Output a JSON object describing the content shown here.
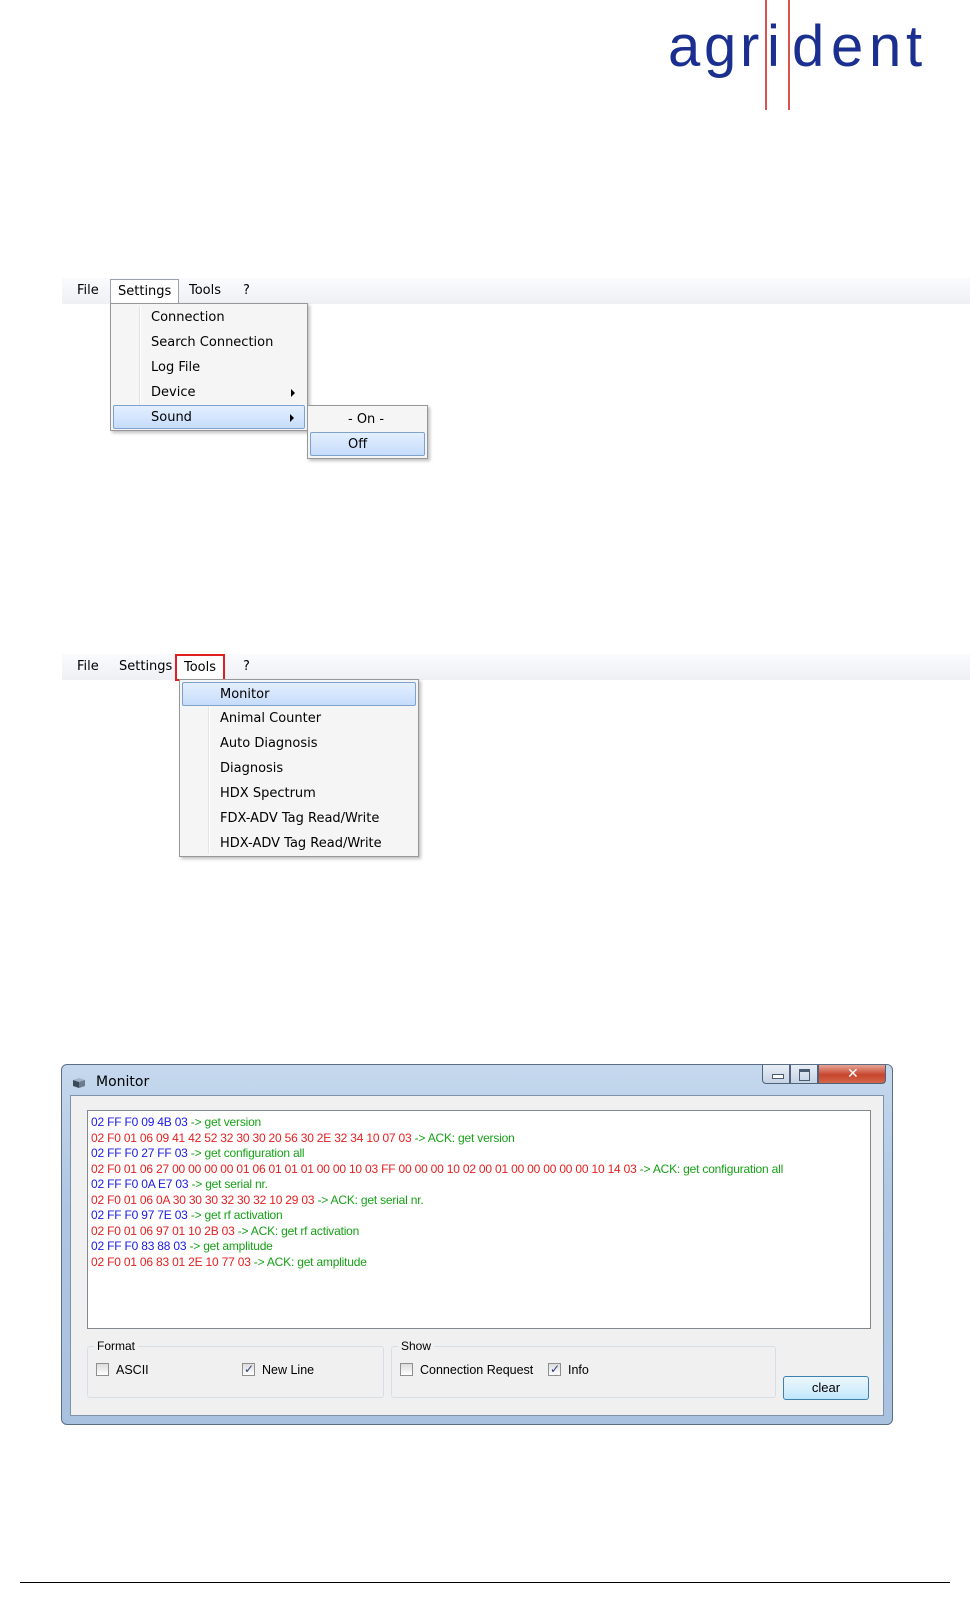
{
  "logo": {
    "text": [
      "a",
      "g",
      "r",
      "i",
      "d",
      "e",
      "n",
      "t"
    ],
    "color": "#1a2f8f",
    "accent": "#d9534f"
  },
  "menu1": {
    "items": [
      "File",
      "Settings",
      "Tools",
      "?"
    ],
    "dropdown": [
      "Connection",
      "Search Connection",
      "Log File",
      "Device",
      "Sound"
    ],
    "submenu": [
      "- On -",
      "Off"
    ]
  },
  "menu2": {
    "items": [
      "File",
      "Settings",
      "Tools",
      "?"
    ],
    "dropdown": [
      "Monitor",
      "Animal Counter",
      "Auto Diagnosis",
      "Diagnosis",
      "HDX Spectrum",
      "FDX-ADV Tag Read/Write",
      "HDX-ADV Tag Read/Write"
    ]
  },
  "monitor": {
    "title": "Monitor",
    "log": [
      {
        "hex": "02 FF F0 09 4B 03",
        "dir": "send",
        "info": " -> get version"
      },
      {
        "hex": "02 F0 01 06 09 41 42 52 32 30 30 20 56 30 2E 32 34 10 07 03",
        "dir": "recv",
        "info": " -> ACK: get version"
      },
      {
        "hex": "02 FF F0 27 FF 03",
        "dir": "send",
        "info": " -> get configuration all"
      },
      {
        "hex": "02 F0 01 06 27 00 00 00 00 01 06 01 01 01 00 00 10 03 FF 00 00 00 10 02 00 01 00 00 00 00 00 10 14 03",
        "dir": "recv",
        "info": " -> ACK: get configuration all"
      },
      {
        "hex": "02 FF F0 0A E7 03",
        "dir": "send",
        "info": " -> get serial nr."
      },
      {
        "hex": "02 F0 01 06 0A 30 30 30 32 30 32 10 29 03",
        "dir": "recv",
        "info": " -> ACK: get serial nr."
      },
      {
        "hex": "02 FF F0 97 7E 03",
        "dir": "send",
        "info": " -> get rf activation"
      },
      {
        "hex": "02 F0 01 06 97 01 10 2B 03",
        "dir": "recv",
        "info": " -> ACK: get rf activation"
      },
      {
        "hex": "02 FF F0 83 88 03",
        "dir": "send",
        "info": " -> get amplitude"
      },
      {
        "hex": "02 F0 01 06 83 01 2E 10 77 03",
        "dir": "recv",
        "info": " -> ACK: get amplitude"
      }
    ],
    "format": {
      "title": "Format",
      "ascii": {
        "label": "ASCII",
        "checked": false
      },
      "newline": {
        "label": "New Line",
        "checked": true
      }
    },
    "show": {
      "title": "Show",
      "connection_request": {
        "label": "Connection Request",
        "checked": false
      },
      "info": {
        "label": "Info",
        "checked": true
      }
    },
    "clear_label": "clear",
    "colors": {
      "send": "#1a1ae6",
      "recv": "#e62020",
      "info": "#16a116"
    }
  }
}
